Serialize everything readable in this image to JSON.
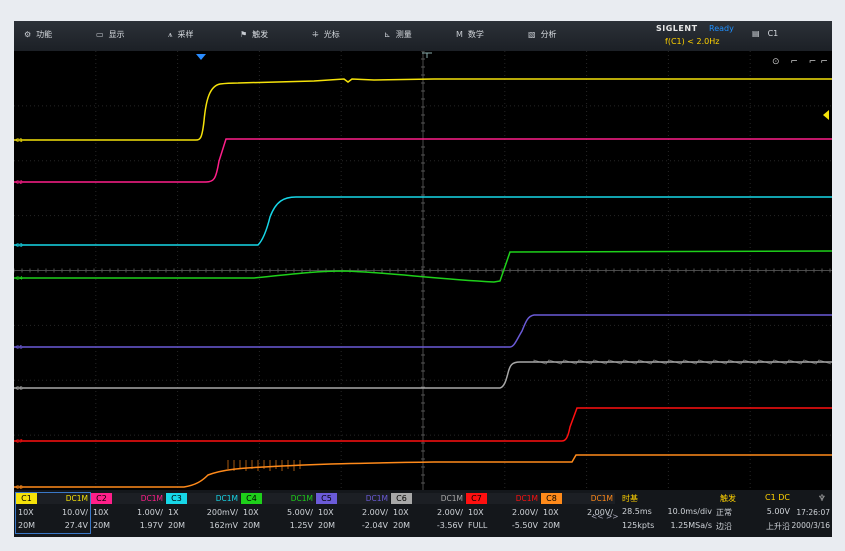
{
  "menu": [
    {
      "icon": "⚙",
      "icon_name": "gear-icon",
      "label": "功能"
    },
    {
      "icon": "▭",
      "icon_name": "monitor-icon",
      "label": "显示"
    },
    {
      "icon": "⩚",
      "icon_name": "sampling-icon",
      "label": "采样"
    },
    {
      "icon": "⚑",
      "icon_name": "flag-icon",
      "label": "触发"
    },
    {
      "icon": "⁜",
      "icon_name": "cursor-icon",
      "label": "光标"
    },
    {
      "icon": "⊾",
      "icon_name": "measure-icon",
      "label": "测量"
    },
    {
      "icon": "M",
      "icon_name": "math-icon",
      "label": "数学"
    },
    {
      "icon": "▧",
      "icon_name": "analysis-icon",
      "label": "分析"
    }
  ],
  "brand": {
    "name": "SIGLENT",
    "status": "Ready",
    "trigger_freq": "f(C1) < 2.0Hz"
  },
  "channel_select": {
    "icon_name": "channel-list-icon",
    "label": "C1"
  },
  "colors": {
    "C1": "#f5e20a",
    "C2": "#ff1f8a",
    "C3": "#17d7e8",
    "C4": "#1ed01a",
    "C5": "#6b5bd8",
    "C6": "#a8a8a8",
    "C7": "#ff1010",
    "C8": "#ff8a1a"
  },
  "channels": [
    {
      "name": "C1",
      "coupling": "DC1M",
      "probe": "10X",
      "scale": "10.0V/",
      "bw": "20M",
      "offset": "27.4V"
    },
    {
      "name": "C2",
      "coupling": "DC1M",
      "probe": "10X",
      "scale": "1.00V/",
      "bw": "20M",
      "offset": "1.97V"
    },
    {
      "name": "C3",
      "coupling": "DC1M",
      "probe": "1X",
      "scale": "200mV/",
      "bw": "20M",
      "offset": "162mV"
    },
    {
      "name": "C4",
      "coupling": "DC1M",
      "probe": "10X",
      "scale": "5.00V/",
      "bw": "20M",
      "offset": "1.25V"
    },
    {
      "name": "C5",
      "coupling": "DC1M",
      "probe": "10X",
      "scale": "2.00V/",
      "bw": "20M",
      "offset": "-2.04V"
    },
    {
      "name": "C6",
      "coupling": "DC1M",
      "probe": "10X",
      "scale": "2.00V/",
      "bw": "20M",
      "offset": "-3.56V"
    },
    {
      "name": "C7",
      "coupling": "DC1M",
      "probe": "10X",
      "scale": "2.00V/",
      "bw": "FULL",
      "offset": "-5.50V"
    },
    {
      "name": "C8",
      "coupling": "DC1M",
      "probe": "10X",
      "scale": "2.00V/",
      "bw": "20M",
      "offset": ""
    }
  ],
  "nav_arrows": "<< >>",
  "timebase": {
    "title": "时基",
    "delay": "28.5ms",
    "scale": "10.0ms/div",
    "points": "125kpts",
    "rate": "1.25MSa/s"
  },
  "trigger": {
    "title": "触发",
    "source": "C1 DC",
    "mode": "正常",
    "level": "5.00V",
    "type": "边沿",
    "slope": "上升沿"
  },
  "clock": {
    "icon_name": "usb-icon",
    "time": "17:26:07",
    "date": "2000/3/16"
  },
  "screen_tools": "⊙ ⌐ ⌐⌐",
  "trace_labels": {
    "C1": "C1",
    "C2": "C2",
    "C3": "C3",
    "C4": "C4",
    "C5": "C5",
    "C6": "C6",
    "C7": "C7",
    "C8": "C8"
  }
}
